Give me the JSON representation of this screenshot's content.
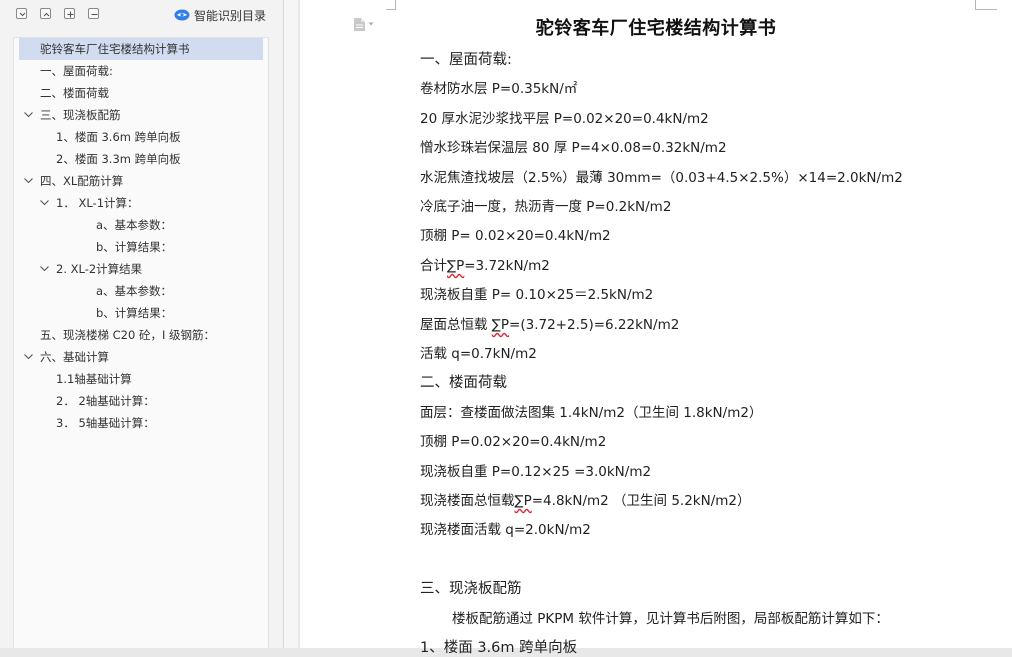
{
  "nav": {
    "smart_toc_label": "智能识别目录",
    "toc": [
      {
        "label": "驼铃客车厂住宅楼结构计算书",
        "level": 0,
        "arrow": "",
        "selected": true
      },
      {
        "label": "一、屋面荷载:",
        "level": 1,
        "arrow": ""
      },
      {
        "label": "二、楼面荷载",
        "level": 1,
        "arrow": ""
      },
      {
        "label": "三、现浇板配筋",
        "level": 1,
        "arrow": "down"
      },
      {
        "label": "1、楼面 3.6m 跨单向板",
        "level": 2,
        "arrow": ""
      },
      {
        "label": "2、楼面 3.3m 跨单向板",
        "level": 2,
        "arrow": ""
      },
      {
        "label": "四、XL配筋计算",
        "level": 1,
        "arrow": "down"
      },
      {
        "label": "1．  XL-1计算：",
        "level": 2,
        "arrow": "down"
      },
      {
        "label": "a、基本参数：",
        "level": 3,
        "arrow": ""
      },
      {
        "label": "b、计算结果：",
        "level": 3,
        "arrow": ""
      },
      {
        "label": "2. XL-2计算结果",
        "level": 2,
        "arrow": "down"
      },
      {
        "label": "a、基本参数：",
        "level": 3,
        "arrow": ""
      },
      {
        "label": "b、计算结果：",
        "level": 3,
        "arrow": ""
      },
      {
        "label": "五、现浇楼梯  C20 砼，I 级钢筋：",
        "level": 1,
        "arrow": ""
      },
      {
        "label": "六、基础计算",
        "level": 1,
        "arrow": "down"
      },
      {
        "label": "1.1轴基础计算",
        "level": 2,
        "arrow": ""
      },
      {
        "label": "2．  2轴基础计算：",
        "level": 2,
        "arrow": ""
      },
      {
        "label": "3．  5轴基础计算：",
        "level": 2,
        "arrow": ""
      }
    ]
  },
  "document": {
    "title": "驼铃客车厂住宅楼结构计算书",
    "lines": [
      {
        "type": "heading",
        "parts": [
          {
            "t": "一、屋面荷载:"
          }
        ]
      },
      {
        "parts": [
          {
            "t": "卷材防水层 P=0.35kN/㎡"
          }
        ]
      },
      {
        "parts": [
          {
            "t": "20 厚水泥沙浆找平层 P=0.02×20=0.4kN/m2"
          }
        ]
      },
      {
        "parts": [
          {
            "t": "憎水珍珠岩保温层 80 厚 P=4×0.08=0.32kN/m2"
          }
        ]
      },
      {
        "parts": [
          {
            "t": "水泥焦渣找坡层（2.5%）最薄 30mm=（0.03+4.5×2.5%）×14=2.0kN/m2"
          }
        ]
      },
      {
        "parts": [
          {
            "t": "冷底子油一度，热沥青一度 P=0.2kN/m2"
          }
        ]
      },
      {
        "parts": [
          {
            "t": "顶棚 P= 0.02×20=0.4kN/m2"
          }
        ]
      },
      {
        "parts": [
          {
            "t": "合计"
          },
          {
            "t": "∑P",
            "sq": true
          },
          {
            "t": "=3.72kN/m2"
          }
        ]
      },
      {
        "parts": [
          {
            "t": "现浇板自重 P=  0.10×25＝2.5kN/m2"
          }
        ]
      },
      {
        "parts": [
          {
            "t": "屋面总恒载 "
          },
          {
            "t": "∑P",
            "sq": true
          },
          {
            "t": "=(3.72+2.5)=6.22kN/m2"
          }
        ]
      },
      {
        "parts": [
          {
            "t": "活载 q=0.7kN/m2"
          }
        ]
      },
      {
        "type": "heading",
        "parts": [
          {
            "t": "二、楼面荷载"
          }
        ]
      },
      {
        "parts": [
          {
            "t": "面层：查楼面做法图集 1.4kN/m2（卫生间 1.8kN/m2）"
          }
        ]
      },
      {
        "parts": [
          {
            "t": "顶棚 P=0.02×20=0.4kN/m2"
          }
        ]
      },
      {
        "parts": [
          {
            "t": "现浇板自重 P=0.12×25 =3.0kN/m2"
          }
        ]
      },
      {
        "parts": [
          {
            "t": "现浇楼面总恒载"
          },
          {
            "t": "∑P",
            "sq": true
          },
          {
            "t": "=4.8kN/m2   （卫生间 5.2kN/m2）"
          }
        ]
      },
      {
        "parts": [
          {
            "t": "现浇楼面活载 q=2.0kN/m2"
          }
        ]
      },
      {
        "type": "gap",
        "parts": []
      },
      {
        "type": "heading",
        "parts": [
          {
            "t": "三、现浇板配筋"
          }
        ]
      },
      {
        "type": "indent",
        "parts": [
          {
            "t": "楼板配筋通过 PKPM 软件计算，见计算书后附图，局部板配筋计算如下："
          }
        ]
      },
      {
        "type": "heading",
        "parts": [
          {
            "t": "1、楼面 3.6m 跨单向板"
          }
        ]
      }
    ]
  }
}
